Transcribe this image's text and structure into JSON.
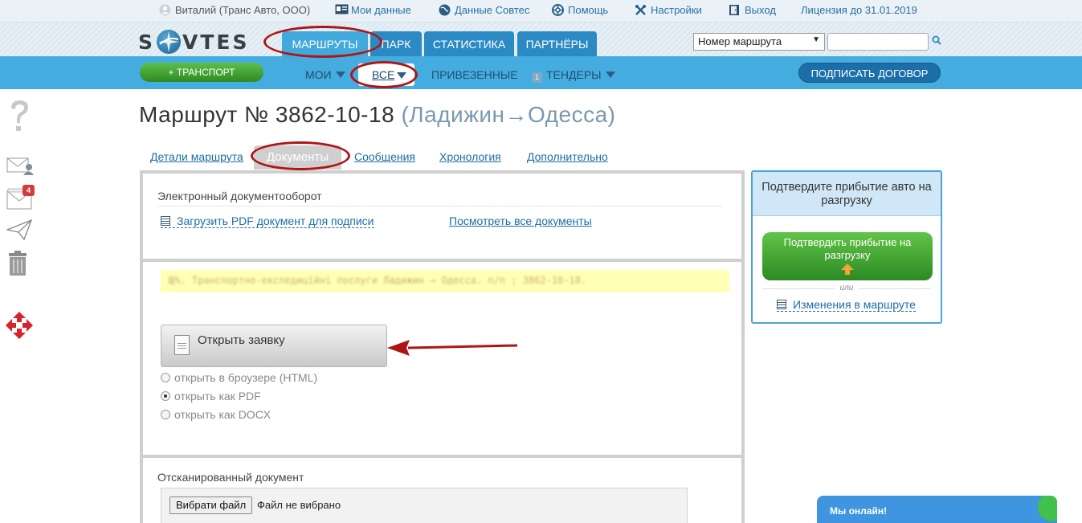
{
  "topbar": {
    "user": "Виталий (Транс Авто, ООО)",
    "my_data": "Мои данные",
    "sovtes_data": "Данные Совтес",
    "help": "Помощь",
    "settings": "Настройки",
    "logout": "Выход",
    "license": "Лицензия до 31.01.2019"
  },
  "logo": {
    "left": "S",
    "right": "VTES"
  },
  "nav": {
    "tabs": [
      "МАРШРУТЫ",
      "ПАРК",
      "СТАТИСТИКА",
      "ПАРТНЁРЫ"
    ],
    "route_select": "Номер маршрута"
  },
  "subnav": {
    "add_transport": "+ ТРАНСПОРТ",
    "mine": "МОИ",
    "all": "ВСЕ",
    "delivered": "ПРИВЕЗЕННЫЕ",
    "tenders_badge": "1",
    "tenders": "ТЕНДЕРЫ",
    "sign_contract": "ПОДПИСАТЬ ДОГОВОР"
  },
  "sidebar": {
    "mail_badge": "4"
  },
  "page": {
    "title": "Маршрут № 3862-10-18",
    "route": "(Ладижин→Одесса)"
  },
  "tabs": {
    "details": "Детали маршрута",
    "documents": "Документы",
    "messages": "Сообщения",
    "chronology": "Хронология",
    "additional": "Дополнительно"
  },
  "edoc": {
    "title": "Электронный документооборот",
    "upload_pdf": "Загрузить PDF документ для подписи",
    "view_all": "Посмотреть все документы"
  },
  "order": {
    "blurred_line": "Щ%. Транспортно-експедиційні послуги Ладижин → Одесса. п/п ; 3862-10-18.",
    "open_button": "Открыть заявку",
    "options": [
      {
        "label": "открыть в броузере (HTML)",
        "selected": false
      },
      {
        "label": "открыть как PDF",
        "selected": true
      },
      {
        "label": "открыть как DOCX",
        "selected": false
      }
    ]
  },
  "scan": {
    "title": "Отсканированный документ",
    "choose_file": "Вибрати файл",
    "no_file": "Файл не вибрано"
  },
  "confirm_panel": {
    "header": "Подтвердите прибытие авто на разгрузку",
    "button": "Подтвердить прибытие на разгрузку",
    "or": "или",
    "route_changes": "Изменения в маршруте"
  },
  "chat": {
    "label": "Мы онлайн!"
  },
  "colors": {
    "nav_blue": "#2b8ac4",
    "subnav_blue": "#45ace0",
    "green": "#2e8a22",
    "link": "#1b6ea5",
    "annotation_red": "#b01515"
  }
}
